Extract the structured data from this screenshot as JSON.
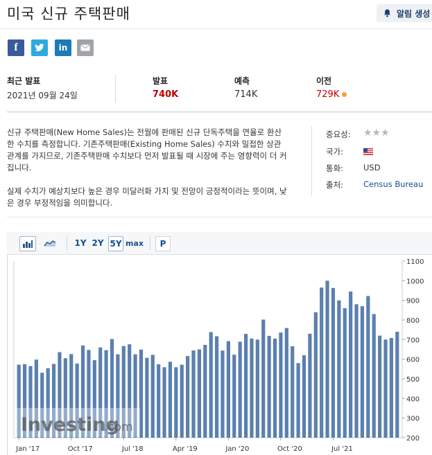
{
  "header": {
    "title": "미국 신규 주택판매",
    "alert_label": "알림 생성"
  },
  "share": {
    "facebook": "f",
    "twitter": "twitter-bird",
    "linkedin": "in",
    "email": "mail"
  },
  "stats": {
    "latest": {
      "label": "최근 발표",
      "value": "2021년 09월 24일"
    },
    "actual": {
      "label": "발표",
      "value": "740K"
    },
    "forecast": {
      "label": "예측",
      "value": "714K"
    },
    "previous": {
      "label": "이전",
      "value": "729K"
    }
  },
  "description": {
    "p1": "신규 주택판매(New Home Sales)는 전월에 판매된 신규 단독주택을 연율로 환산한 수치를 측정합니다. 기존주택판매(Existing Home Sales) 수치와 밀접한 상관관계를 가지므로, 기존주택판매 수치보다 먼저 발표될 때 시장에 주는 영향력이 더 커집니다.",
    "p2": "실제 수치가 예상치보다 높은 경우 미달러화 가치 및 전망이 긍정적이라는 뜻이며, 낮은 경우 부정적임을 의미합니다."
  },
  "info": {
    "importance_label": "중요성:",
    "country_label": "국가:",
    "currency_label": "통화:",
    "currency_value": "USD",
    "source_label": "출처:",
    "source_value": "Census Bureau"
  },
  "toolbar": {
    "r1y": "1Y",
    "r2y": "2Y",
    "r5y": "5Y",
    "rmax": "max",
    "p": "P"
  },
  "watermark": {
    "brand": "Investing",
    "suffix": ".com"
  },
  "colors": {
    "actual_red": "#c00000",
    "previous_red": "#c00000",
    "bar": "#5b80ae",
    "dot": "#f0a33a"
  },
  "chart_data": {
    "type": "bar",
    "x_tick_labels": [
      "Jan '17",
      "Oct '17",
      "Jul '18",
      "Apr '19",
      "Jan '20",
      "Oct '20",
      "Jul '21"
    ],
    "y_tick_labels": [
      "200",
      "300",
      "400",
      "500",
      "600",
      "700",
      "800",
      "900",
      "1000",
      "1100"
    ],
    "ylim": [
      200,
      1100
    ],
    "values": [
      572,
      575,
      565,
      598,
      531,
      554,
      576,
      636,
      605,
      626,
      578,
      670,
      647,
      595,
      660,
      646,
      703,
      625,
      667,
      676,
      625,
      649,
      607,
      622,
      574,
      559,
      587,
      559,
      572,
      616,
      645,
      650,
      673,
      738,
      717,
      644,
      692,
      623,
      689,
      729,
      705,
      700,
      802,
      719,
      705,
      736,
      759,
      666,
      580,
      620,
      730,
      839,
      965,
      1000,
      963,
      900,
      860,
      945,
      880,
      870,
      922,
      830,
      720,
      700,
      708,
      740
    ]
  }
}
